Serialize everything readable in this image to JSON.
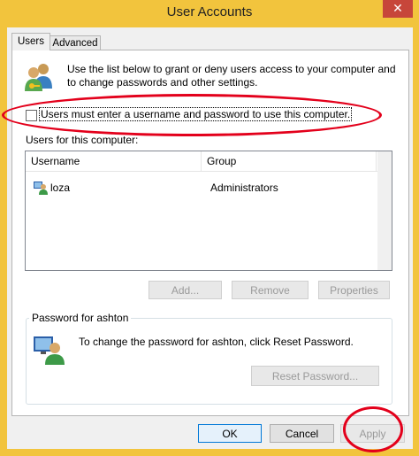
{
  "window": {
    "title": "User Accounts",
    "close_glyph": "✕"
  },
  "tabs": [
    {
      "label": "Users"
    },
    {
      "label": "Advanced"
    }
  ],
  "intro": {
    "text": "Use the list below to grant or deny users access to your computer and to change passwords and other settings.",
    "icon": "users-icon"
  },
  "require_login": {
    "label": "Users must enter a username and password to use this computer.",
    "checked": false
  },
  "users_list": {
    "label": "Users for this computer:",
    "columns": [
      "Username",
      "Group"
    ],
    "rows": [
      {
        "username": "loza",
        "group": "Administrators",
        "icon": "user-icon"
      }
    ]
  },
  "buttons": {
    "add": "Add...",
    "remove": "Remove",
    "properties": "Properties",
    "reset_password": "Reset Password...",
    "ok": "OK",
    "cancel": "Cancel",
    "apply": "Apply"
  },
  "password_group": {
    "legend": "Password for ashton",
    "text": "To change the password for ashton, click Reset Password.",
    "icon": "user-key-icon"
  },
  "annotation_color": "#e3001b"
}
